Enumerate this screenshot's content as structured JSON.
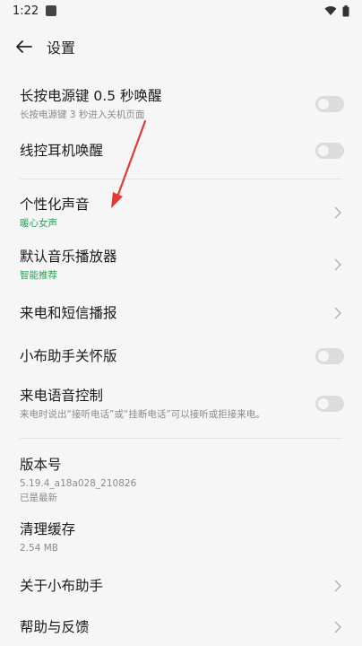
{
  "status_bar": {
    "time": "1:22"
  },
  "header": {
    "title": "设置"
  },
  "rows": [
    {
      "label": "长按电源键 0.5 秒唤醒",
      "sub": "长按电源键 3 秒进入关机页面"
    },
    {
      "label": "线控耳机唤醒"
    },
    {
      "label": "个性化声音",
      "sub": "暖心女声"
    },
    {
      "label": "默认音乐播放器",
      "sub": "智能推荐"
    },
    {
      "label": "来电和短信播报"
    },
    {
      "label": "小布助手关怀版"
    },
    {
      "label": "来电语音控制",
      "sub": "来电时说出“接听电话”或“挂断电话”可以接听或拒接来电。"
    },
    {
      "label": "版本号",
      "sub": "5.19.4_a18a028_210826",
      "sub2": "已是最新"
    },
    {
      "label": "清理缓存",
      "sub": "2.54 MB"
    },
    {
      "label": "关于小布助手"
    },
    {
      "label": "帮助与反馈"
    }
  ],
  "colors": {
    "accent_green": "#2f9f5a",
    "annotation_red": "#e53935"
  }
}
